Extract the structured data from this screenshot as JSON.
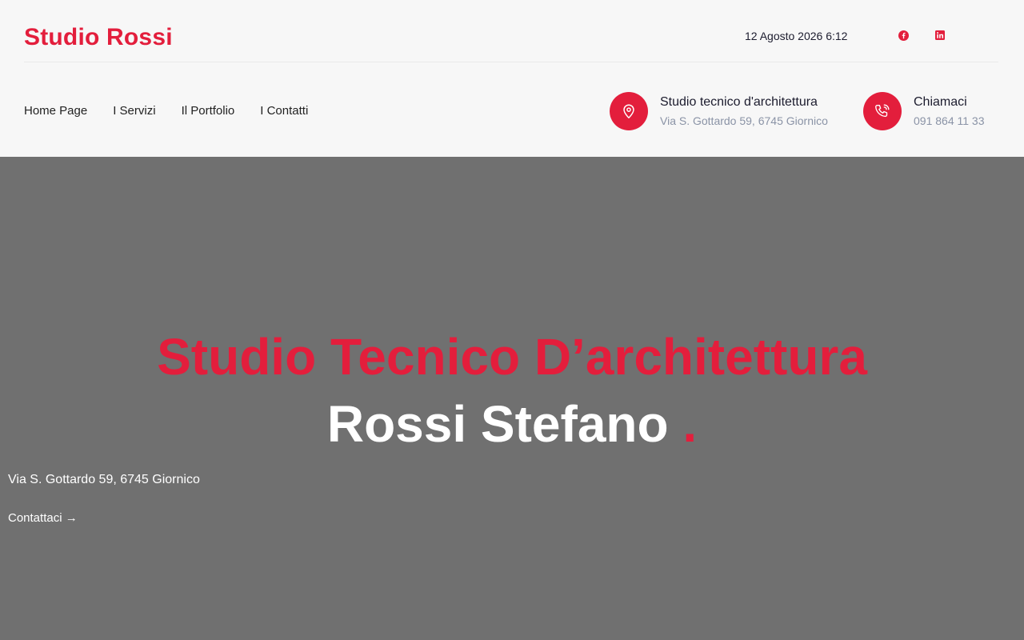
{
  "header": {
    "logo": "Studio Rossi",
    "datetime": "12 Agosto 2026 6:12",
    "social": [
      {
        "name": "facebook-icon",
        "color": "#e31e3c"
      },
      {
        "name": "linkedin-icon",
        "color": "#e31e3c"
      }
    ],
    "nav": [
      {
        "label": "Home Page"
      },
      {
        "label": "I Servizi"
      },
      {
        "label": "Il Portfolio"
      },
      {
        "label": "I Contatti"
      }
    ],
    "address_box": {
      "icon": "map-pin-icon",
      "title": "Studio tecnico d'architettura",
      "subtitle": "Via S. Gottardo 59, 6745 Giornico"
    },
    "phone_box": {
      "icon": "phone-icon",
      "title": "Chiamaci",
      "subtitle": "091 864 11 33"
    }
  },
  "hero": {
    "title": "Studio Tecnico D’architettura",
    "subtitle": "Rossi Stefano",
    "subtitle_dot": ".",
    "address": "Via S. Gottardo 59, 6745 Giornico",
    "cta_label": "Contattaci",
    "cta_arrow": "→"
  },
  "colors": {
    "accent": "#e31e3c",
    "header_bg": "#f7f7f7",
    "hero_bg": "#707070"
  }
}
